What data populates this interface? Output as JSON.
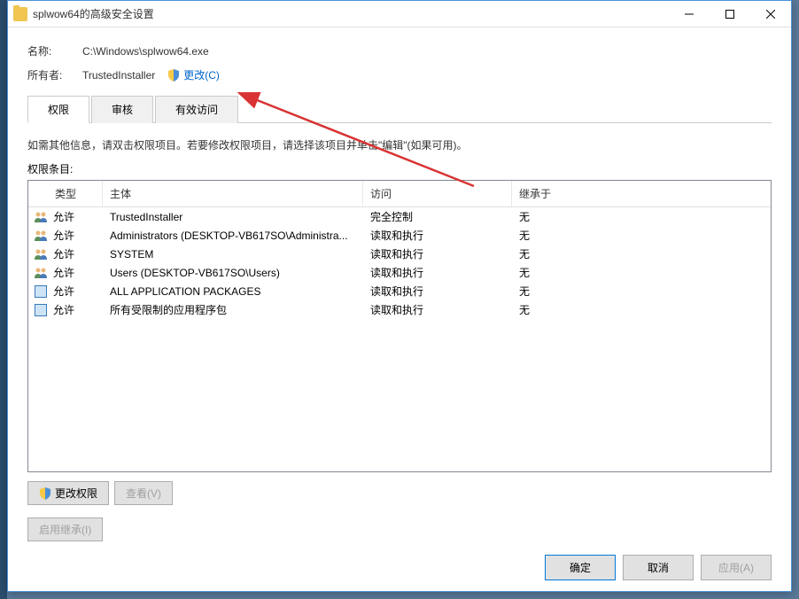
{
  "window": {
    "title": "splwow64的高级安全设置"
  },
  "fields": {
    "nameLabel": "名称:",
    "nameValue": "C:\\Windows\\splwow64.exe",
    "ownerLabel": "所有者:",
    "ownerValue": "TrustedInstaller",
    "changeLink": "更改(C)"
  },
  "tabs": {
    "permissions": "权限",
    "audit": "审核",
    "effective": "有效访问"
  },
  "instruction": "如需其他信息，请双击权限项目。若要修改权限项目，请选择该项目并单击\"编辑\"(如果可用)。",
  "sectionLabel": "权限条目:",
  "columns": {
    "type": "类型",
    "principal": "主体",
    "access": "访问",
    "inherit": "继承于"
  },
  "entries": [
    {
      "icon": "people",
      "type": "允许",
      "principal": "TrustedInstaller",
      "access": "完全控制",
      "inherit": "无"
    },
    {
      "icon": "people",
      "type": "允许",
      "principal": "Administrators (DESKTOP-VB617SO\\Administra...",
      "access": "读取和执行",
      "inherit": "无"
    },
    {
      "icon": "people",
      "type": "允许",
      "principal": "SYSTEM",
      "access": "读取和执行",
      "inherit": "无"
    },
    {
      "icon": "people",
      "type": "允许",
      "principal": "Users (DESKTOP-VB617SO\\Users)",
      "access": "读取和执行",
      "inherit": "无"
    },
    {
      "icon": "pkg",
      "type": "允许",
      "principal": "ALL APPLICATION PACKAGES",
      "access": "读取和执行",
      "inherit": "无"
    },
    {
      "icon": "pkg",
      "type": "允许",
      "principal": "所有受限制的应用程序包",
      "access": "读取和执行",
      "inherit": "无"
    }
  ],
  "buttons": {
    "changePerm": "更改权限",
    "view": "查看(V)",
    "enableInherit": "启用继承(I)",
    "ok": "确定",
    "cancel": "取消",
    "apply": "应用(A)"
  }
}
